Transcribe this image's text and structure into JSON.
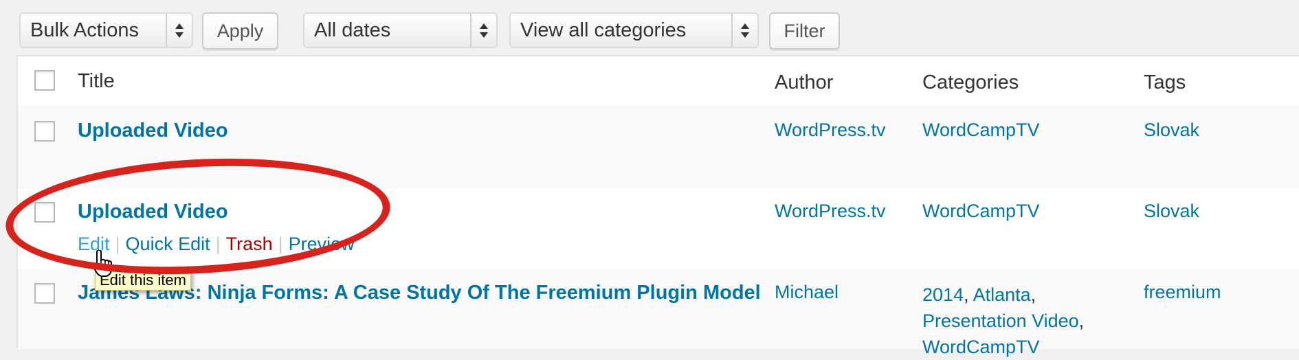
{
  "toolbar": {
    "bulk_actions": "Bulk Actions",
    "apply": "Apply",
    "dates": "All dates",
    "categories": "View all categories",
    "filter": "Filter"
  },
  "columns": {
    "title": "Title",
    "author": "Author",
    "categories": "Categories",
    "tags": "Tags"
  },
  "rows": [
    {
      "title": "Uploaded Video",
      "author": "WordPress.tv",
      "categories": [
        "WordCampTV"
      ],
      "tags": "Slovak"
    },
    {
      "title": "Uploaded Video",
      "author": "WordPress.tv",
      "categories": [
        "WordCampTV"
      ],
      "tags": "Slovak",
      "actions": {
        "edit": "Edit",
        "quick_edit": "Quick Edit",
        "trash": "Trash",
        "preview": "Preview"
      }
    },
    {
      "title": "James Laws: Ninja Forms: A Case Study Of The Freemium Plugin Model",
      "author": "Michael",
      "categories": [
        "2014",
        "Atlanta",
        "Presentation Video",
        "WordCampTV"
      ],
      "tags": "freemium"
    }
  ],
  "tooltip": "Edit this item",
  "colors": {
    "link": "#0074a2",
    "hover_link": "#2ea2cc",
    "trash": "#aa0000",
    "annotation": "#d8231c",
    "tooltip_bg": "#ffffc8"
  },
  "icons": [
    "select-arrows-icon",
    "hand-cursor-icon"
  ]
}
